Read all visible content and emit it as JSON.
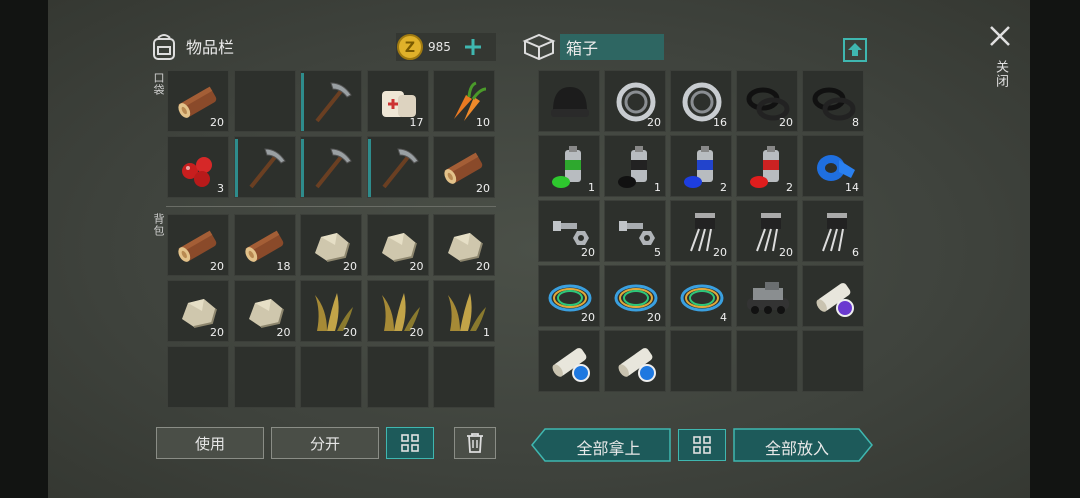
{
  "inventory": {
    "title": "物品栏",
    "coins": "985",
    "pocket_label": "口袋",
    "backpack_label": "背包"
  },
  "box": {
    "title": "箱子"
  },
  "close": {
    "label": "关闭"
  },
  "buttons": {
    "use": "使用",
    "split": "分开",
    "take_all": "全部拿上",
    "put_all": "全部放入"
  },
  "colors": {
    "accent": "#3fb7b0",
    "coin": "#e0b12a"
  },
  "pocket_slots": [
    {
      "item": "wood-log",
      "count": "20"
    },
    {
      "item": "",
      "count": ""
    },
    {
      "item": "pickaxe",
      "count": ""
    },
    {
      "item": "bandage",
      "count": "17"
    },
    {
      "item": "carrot",
      "count": "10"
    },
    {
      "item": "berries",
      "count": "3"
    },
    {
      "item": "pickaxe",
      "count": ""
    },
    {
      "item": "pickaxe",
      "count": ""
    },
    {
      "item": "pickaxe",
      "count": ""
    },
    {
      "item": "wood-log",
      "count": "20"
    }
  ],
  "backpack_slots": [
    {
      "item": "wood-log",
      "count": "20"
    },
    {
      "item": "wood-log",
      "count": "18"
    },
    {
      "item": "stone",
      "count": "20"
    },
    {
      "item": "stone",
      "count": "20"
    },
    {
      "item": "stone",
      "count": "20"
    },
    {
      "item": "stone",
      "count": "20"
    },
    {
      "item": "stone",
      "count": "20"
    },
    {
      "item": "plant-fiber",
      "count": "20"
    },
    {
      "item": "plant-fiber",
      "count": "20"
    },
    {
      "item": "plant-fiber",
      "count": "1"
    },
    {
      "item": "",
      "count": ""
    },
    {
      "item": "",
      "count": ""
    },
    {
      "item": "",
      "count": ""
    },
    {
      "item": "",
      "count": ""
    },
    {
      "item": "",
      "count": ""
    }
  ],
  "box_slots": [
    {
      "item": "black-beanie",
      "count": ""
    },
    {
      "item": "bearing",
      "count": "20"
    },
    {
      "item": "bearing",
      "count": "16"
    },
    {
      "item": "rubber-seal",
      "count": "20"
    },
    {
      "item": "rubber-seal",
      "count": "8"
    },
    {
      "item": "spray-paint-green",
      "count": "1"
    },
    {
      "item": "spray-paint-black",
      "count": "1"
    },
    {
      "item": "spray-paint-blue",
      "count": "2"
    },
    {
      "item": "spray-paint-red",
      "count": "2"
    },
    {
      "item": "blue-tape",
      "count": "14"
    },
    {
      "item": "bolt-nut",
      "count": "20"
    },
    {
      "item": "bolt-nut",
      "count": "5"
    },
    {
      "item": "transistor",
      "count": "20"
    },
    {
      "item": "transistor",
      "count": "20"
    },
    {
      "item": "transistor",
      "count": "6"
    },
    {
      "item": "wires",
      "count": "20"
    },
    {
      "item": "wires",
      "count": "20"
    },
    {
      "item": "wires",
      "count": "4"
    },
    {
      "item": "tank-vehicle",
      "count": ""
    },
    {
      "item": "blueprint-purple",
      "count": ""
    },
    {
      "item": "blueprint-blue",
      "count": ""
    },
    {
      "item": "blueprint-blue",
      "count": ""
    },
    {
      "item": "",
      "count": ""
    },
    {
      "item": "",
      "count": ""
    },
    {
      "item": "",
      "count": ""
    }
  ]
}
